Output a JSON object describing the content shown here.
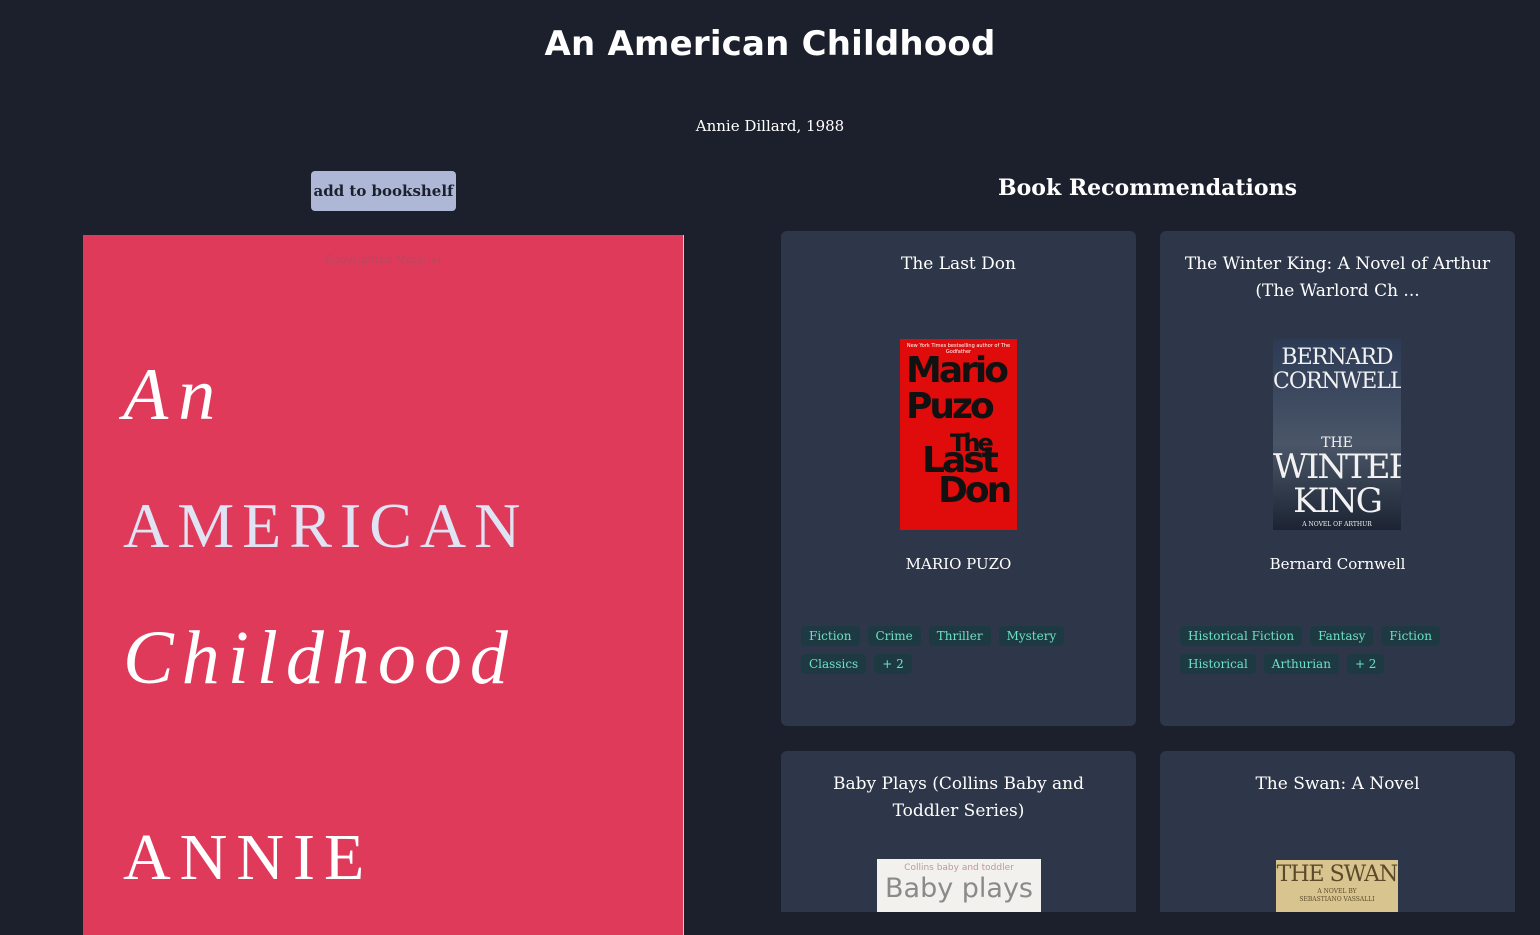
{
  "page": {
    "title": "An American Childhood",
    "byline": "Annie Dillard, 1988",
    "add_button_label": "add to bookshelf"
  },
  "main_cover": {
    "copyright": "Copyrighted Material",
    "line1": "An",
    "line2": "AMERICAN",
    "line3": "Childhood",
    "line4": "ANNIE"
  },
  "recommendations": {
    "heading": "Book Recommendations",
    "books": [
      {
        "title": "The Last Don",
        "author": "MARIO PUZO",
        "cover": {
          "top_text": "New York Times bestselling author of The Godfather",
          "lines": [
            "Mario",
            "Puzo",
            "The",
            "Last",
            "Don"
          ]
        },
        "tags": [
          "Fiction",
          "Crime",
          "Thriller",
          "Mystery",
          "Classics",
          "+ 2"
        ]
      },
      {
        "title": "The Winter King: A Novel of Arthur (The Warlord Ch ...",
        "author": "Bernard Cornwell",
        "cover": {
          "lines": [
            "BERNARD",
            "CORNWELL",
            "THE",
            "WINTER",
            "KING",
            "A NOVEL OF ARTHUR"
          ]
        },
        "tags": [
          "Historical Fiction",
          "Fantasy",
          "Fiction",
          "Historical",
          "Arthurian",
          "+ 2"
        ]
      },
      {
        "title": "Baby Plays (Collins Baby and Toddler Series)",
        "cover": {
          "top_text": "Collins baby and toddler",
          "lines": [
            "Baby plays"
          ]
        }
      },
      {
        "title": "The Swan: A Novel",
        "cover": {
          "lines": [
            "THE SWAN",
            "A NOVEL BY",
            "SEBASTIANO VASSALLI"
          ]
        }
      }
    ]
  },
  "colors": {
    "background": "#1b202c",
    "card": "#2e3749",
    "button": "#aeb8d6",
    "tag_text": "#6ee0c8",
    "main_cover": "#e03a5b"
  }
}
